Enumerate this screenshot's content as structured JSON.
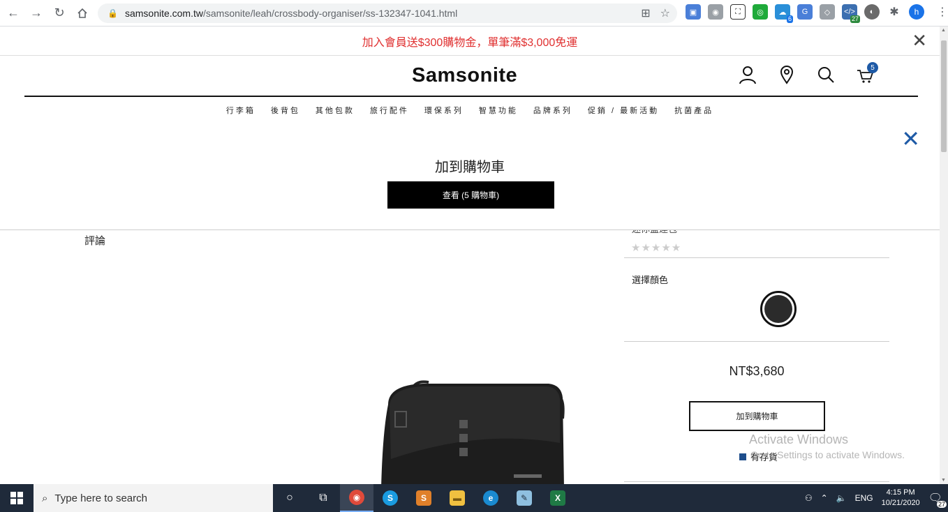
{
  "browser": {
    "url_host": "samsonite.com.tw",
    "url_path": "/samsonite/leah/crossbody-organiser/ss-132347-1041.html",
    "profile_initial": "h",
    "ext_badges": {
      "meet": "6",
      "dev": "27"
    }
  },
  "promo": {
    "text": "加入會員送$300購物金，單筆滿$3,000免運"
  },
  "header": {
    "logo": "Samsonite",
    "cart_count": "5"
  },
  "categories": [
    "行李箱",
    "後背包",
    "其他包款",
    "旅行配件",
    "環保系列",
    "智慧功能",
    "品牌系列",
    "促銷 / 最新活動",
    "抗菌產品"
  ],
  "overlay": {
    "title": "加到購物車",
    "view_cart_label": "查看 (5 購物車)"
  },
  "product": {
    "reviews_label": "評論",
    "partial_title": "迷你盛達包",
    "stars": "★★★★★",
    "color_label": "選擇顏色",
    "price": "NT$3,680",
    "add_to_cart_label": "加到購物車",
    "stock_label": "有存貨"
  },
  "watermark": {
    "line1": "Activate Windows",
    "line2": "Go to Settings to activate Windows."
  },
  "taskbar": {
    "search_placeholder": "Type here to search",
    "lang": "ENG",
    "time": "4:15 PM",
    "date": "10/21/2020",
    "notif_count": "27"
  }
}
